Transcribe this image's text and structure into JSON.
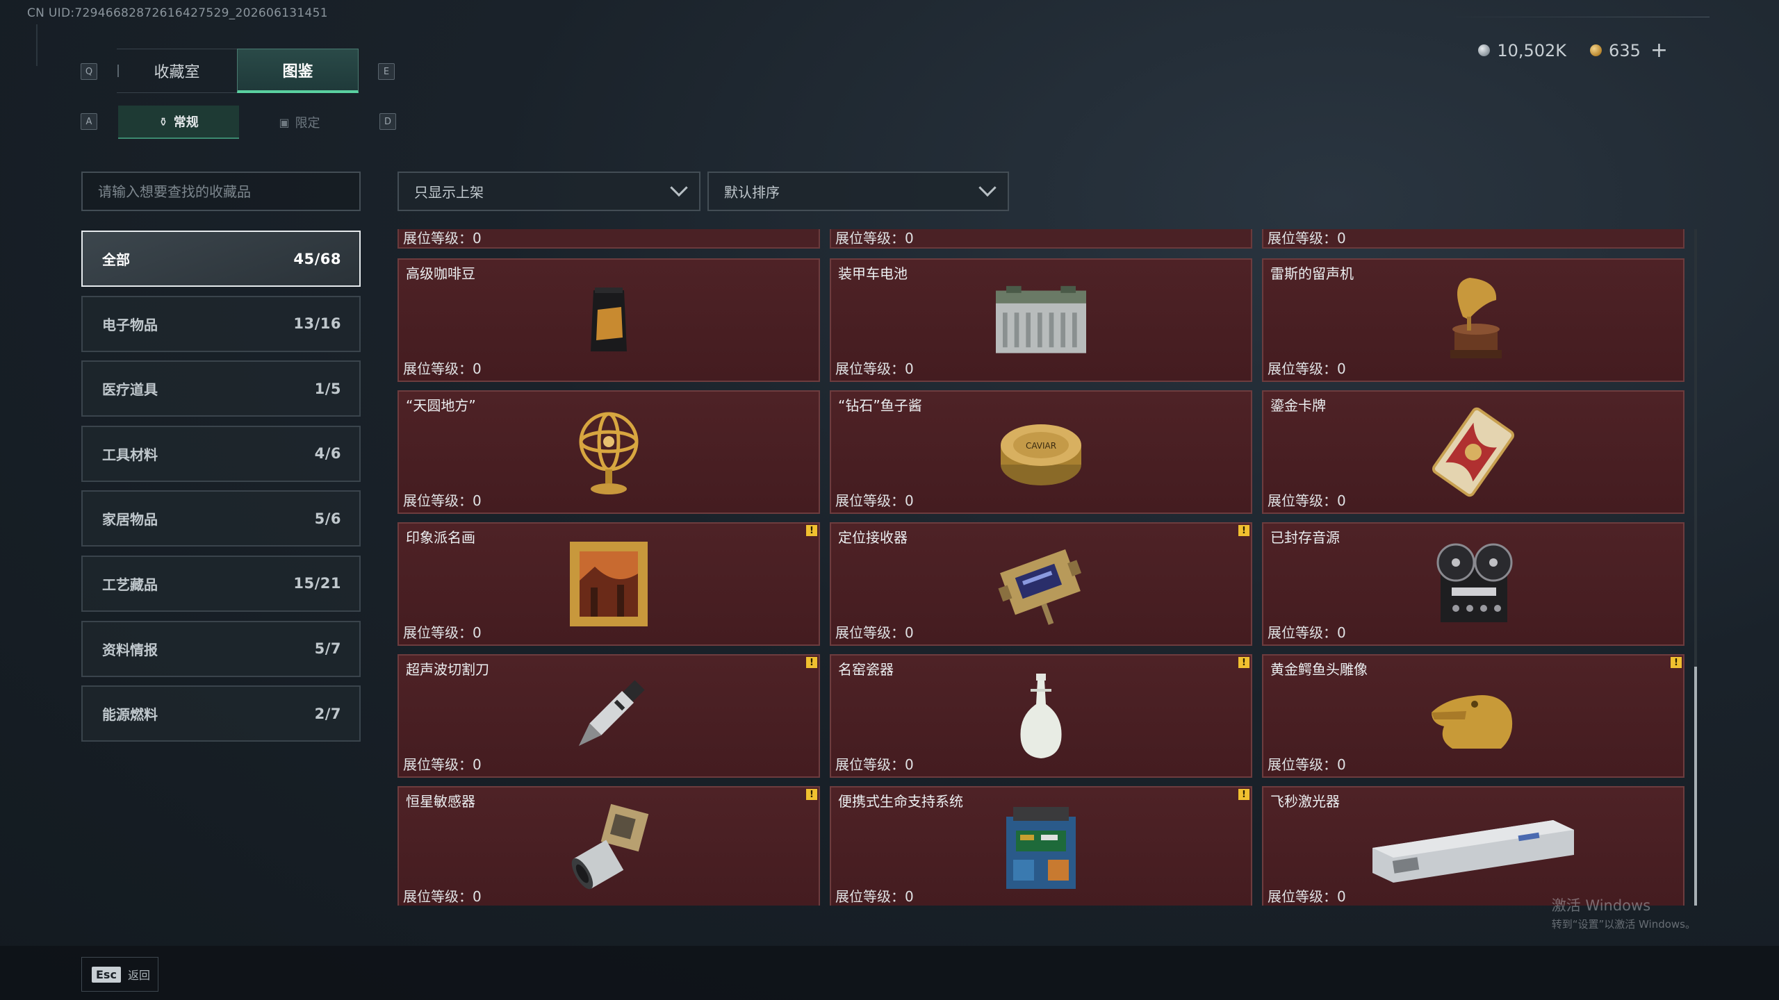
{
  "uid": "CN UID:72946682872616427529_202606131451",
  "currency": {
    "silver": "10,502K",
    "gold": "635",
    "plus": "+"
  },
  "keys": {
    "q": "Q",
    "e": "E",
    "a": "A",
    "d": "D"
  },
  "main_tabs": [
    {
      "label": "收藏室",
      "active": false
    },
    {
      "label": "图鉴",
      "active": true
    }
  ],
  "sub_tabs": [
    {
      "label": "常规",
      "active": true
    },
    {
      "label": "限定",
      "active": false
    }
  ],
  "search": {
    "placeholder": "请输入想要查找的收藏品"
  },
  "filter": {
    "value": "只显示上架"
  },
  "sort": {
    "value": "默认排序"
  },
  "categories": [
    {
      "label": "全部",
      "count": "45/68",
      "active": true
    },
    {
      "label": "电子物品",
      "count": "13/16"
    },
    {
      "label": "医疗道具",
      "count": "1/5"
    },
    {
      "label": "工具材料",
      "count": "4/6"
    },
    {
      "label": "家居物品",
      "count": "5/6"
    },
    {
      "label": "工艺藏品",
      "count": "15/21"
    },
    {
      "label": "资料情报",
      "count": "5/7"
    },
    {
      "label": "能源燃料",
      "count": "2/7"
    }
  ],
  "level_label": "展位等级：0",
  "items": [
    {
      "name": "高级咖啡豆",
      "icon": "coffee-bag-icon",
      "badge": false
    },
    {
      "name": "装甲车电池",
      "icon": "battery-icon",
      "badge": false
    },
    {
      "name": "雷斯的留声机",
      "icon": "gramophone-icon",
      "badge": false
    },
    {
      "name": "“天圆地方”",
      "icon": "armillary-sphere-icon",
      "badge": false
    },
    {
      "name": "“钻石”鱼子酱",
      "icon": "caviar-tin-icon",
      "badge": false
    },
    {
      "name": "鎏金卡牌",
      "icon": "gilded-card-icon",
      "badge": false
    },
    {
      "name": "印象派名画",
      "icon": "framed-painting-icon",
      "badge": true
    },
    {
      "name": "定位接收器",
      "icon": "locator-receiver-icon",
      "badge": true
    },
    {
      "name": "已封存音源",
      "icon": "reel-tape-icon",
      "badge": false
    },
    {
      "name": "超声波切割刀",
      "icon": "ultrasonic-cutter-icon",
      "badge": true
    },
    {
      "name": "名窑瓷器",
      "icon": "porcelain-vase-icon",
      "badge": true
    },
    {
      "name": "黄金鳄鱼头雕像",
      "icon": "gold-crocodile-icon",
      "badge": true
    },
    {
      "name": "恒星敏感器",
      "icon": "star-sensor-icon",
      "badge": true
    },
    {
      "name": "便携式生命支持系统",
      "icon": "life-support-icon",
      "badge": true
    },
    {
      "name": "飞秒激光器",
      "icon": "femto-laser-icon",
      "badge": false
    }
  ],
  "badge_mark": "!",
  "caviar_text": "CAVIAR",
  "back": {
    "key": "Esc",
    "label": "返回"
  },
  "watermark": {
    "line1": "激活 Windows",
    "line2": "转到“设置”以激活 Windows。"
  }
}
